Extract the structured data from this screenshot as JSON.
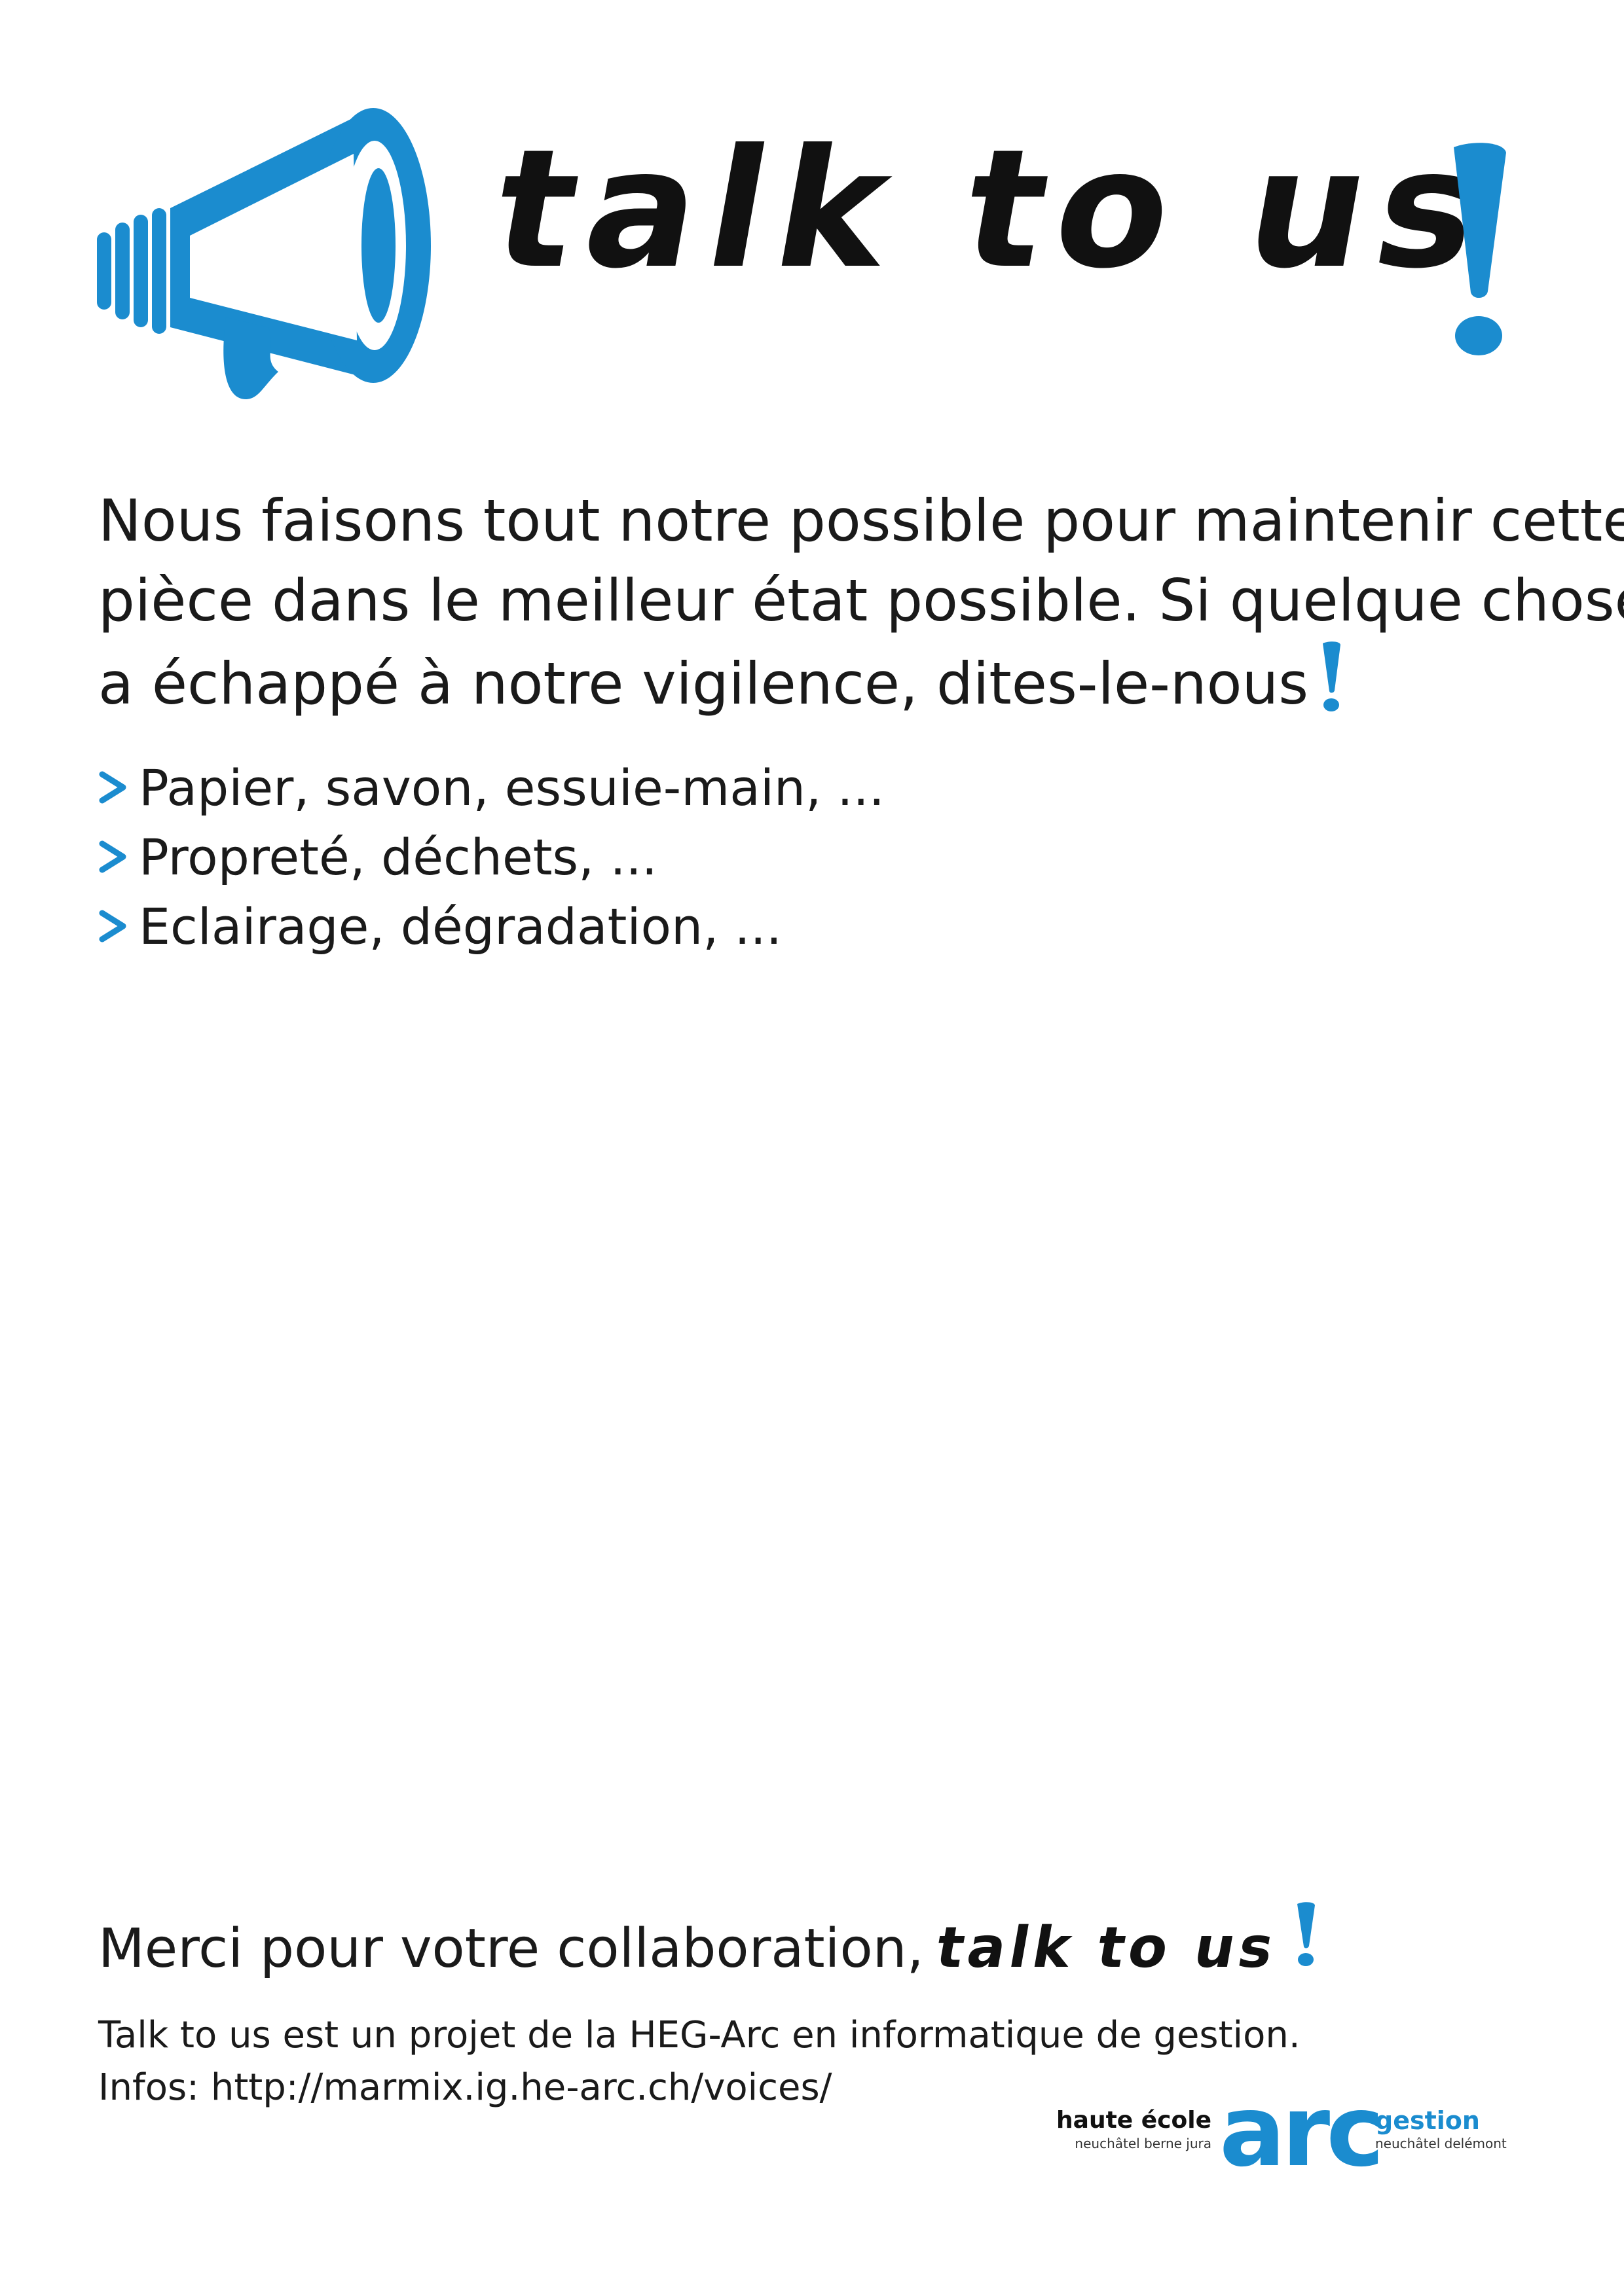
{
  "colors": {
    "accent": "#1b8ccf",
    "text": "#1a1a1a",
    "background": "#ffffff"
  },
  "header": {
    "icon": "megaphone-icon",
    "headline": "talk to us",
    "headline_punct_icon": "exclamation-icon"
  },
  "intro": {
    "lines": [
      "Nous faisons tout notre possible pour maintenir cette",
      "pièce dans le meilleur état possible. Si quelque chose",
      "a échappé à notre vigilence, dites-le-nous"
    ]
  },
  "list": {
    "bullet_icon": "chevron-right-icon",
    "items": [
      "Papier, savon, essuie-main, ...",
      "Propreté, déchets, ...",
      "Eclairage, dégradation, ..."
    ]
  },
  "footer": {
    "thanks_text": "Merci pour votre collaboration,",
    "thanks_tagline": "talk to us",
    "info_lines": [
      "Talk to us est un projet de la HEG-Arc en informatique de gestion.",
      "Infos: http://marmix.ig.he-arc.ch/voices/"
    ]
  },
  "logo": {
    "school": "haute école",
    "school_sub": "neuchâtel berne jura",
    "mark": "arc",
    "department": "gestion",
    "department_sub": "neuchâtel delémont"
  }
}
